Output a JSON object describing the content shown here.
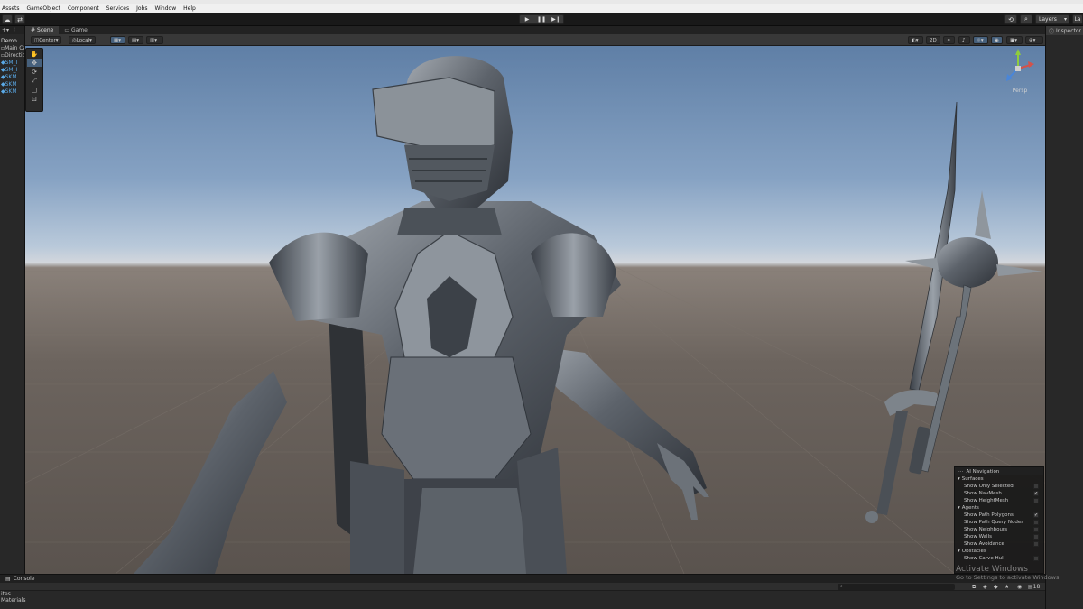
{
  "menu": [
    "Assets",
    "GameObject",
    "Component",
    "Services",
    "Jobs",
    "Window",
    "Help"
  ],
  "toolbar": {
    "play": "▶",
    "pause": "❚❚",
    "step": "▶❙",
    "layers_label": "Layers",
    "layout_label": "La"
  },
  "hierarchy": {
    "scene_name": "Demo",
    "items": [
      {
        "label": "Main Ca",
        "blue": false
      },
      {
        "label": "Directio",
        "blue": false
      },
      {
        "label": "SM_I",
        "blue": true
      },
      {
        "label": "SM_I",
        "blue": true
      },
      {
        "label": "SKM",
        "blue": true
      },
      {
        "label": "SKM",
        "blue": true
      },
      {
        "label": "SKM",
        "blue": true
      }
    ]
  },
  "scene_tabs": [
    {
      "label": "Scene",
      "active": true
    },
    {
      "label": "Game",
      "active": false
    }
  ],
  "scene_toolbar": {
    "pivot": "Center",
    "space": "Local",
    "mode_2d": "2D"
  },
  "gizmo": {
    "view_label": "Persp"
  },
  "inspector_tab": "Inspector",
  "ai_navigation": {
    "title": "AI Navigation",
    "sections": [
      {
        "name": "Surfaces",
        "rows": [
          {
            "label": "Show Only Selected",
            "checked": false
          },
          {
            "label": "Show NavMesh",
            "checked": true
          },
          {
            "label": "Show HeightMesh",
            "checked": false
          }
        ]
      },
      {
        "name": "Agents",
        "rows": [
          {
            "label": "Show Path Polygons",
            "checked": true
          },
          {
            "label": "Show Path Query Nodes",
            "checked": false
          },
          {
            "label": "Show Neighbours",
            "checked": false
          },
          {
            "label": "Show Walls",
            "checked": false
          },
          {
            "label": "Show Avoidance",
            "checked": false
          }
        ]
      },
      {
        "name": "Obstacles",
        "rows": [
          {
            "label": "Show Carve Hull",
            "checked": false
          }
        ]
      }
    ]
  },
  "console": {
    "tab": "Console",
    "project_items": [
      "ites",
      "Materials"
    ],
    "count": "18"
  },
  "watermark": {
    "line1": "Activate Windows",
    "line2": "Go to Settings to activate Windows."
  },
  "colors": {
    "accent": "#46607c",
    "hierarchy_prefab": "#5aa9e6",
    "axis_x": "#d3524a",
    "axis_y": "#8fcc3d",
    "axis_z": "#4a86d8"
  }
}
